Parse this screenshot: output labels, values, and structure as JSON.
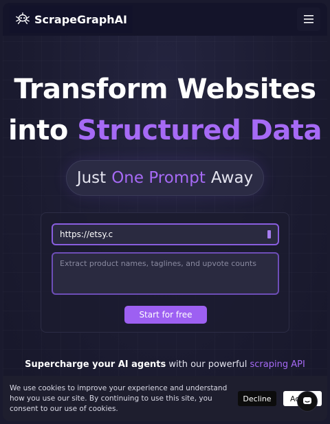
{
  "nav": {
    "brand_name": "ScrapeGraphAI",
    "logo_icon": "robot-spider-logo",
    "menu_icon": "hamburger-menu-icon"
  },
  "hero": {
    "title_line1": "Transform Websites",
    "title_line2_plain": "into ",
    "title_line2_accent": "Structured Data",
    "pill_part1": "Just",
    "pill_accent": "One Prompt",
    "pill_part3": "Away"
  },
  "form": {
    "url_value": "https://etsy.c",
    "prompt_placeholder": "Extract product names, taglines, and upvote counts",
    "start_label": "Start for free"
  },
  "tagline": {
    "bold": "Supercharge your AI agents",
    "middle": " with our powerful ",
    "accent": "scraping API"
  },
  "cookie": {
    "text": "We use cookies to improve your experience and understand how you use our site. By continuing to use this site, you consent to our use of cookies.",
    "decline_label": "Decline",
    "accept_label": "Accept",
    "chat_icon": "chat-bubble-icon"
  },
  "colors": {
    "accent": "#a66af5",
    "button": "#9d60f2",
    "background": "#1b1b30"
  }
}
